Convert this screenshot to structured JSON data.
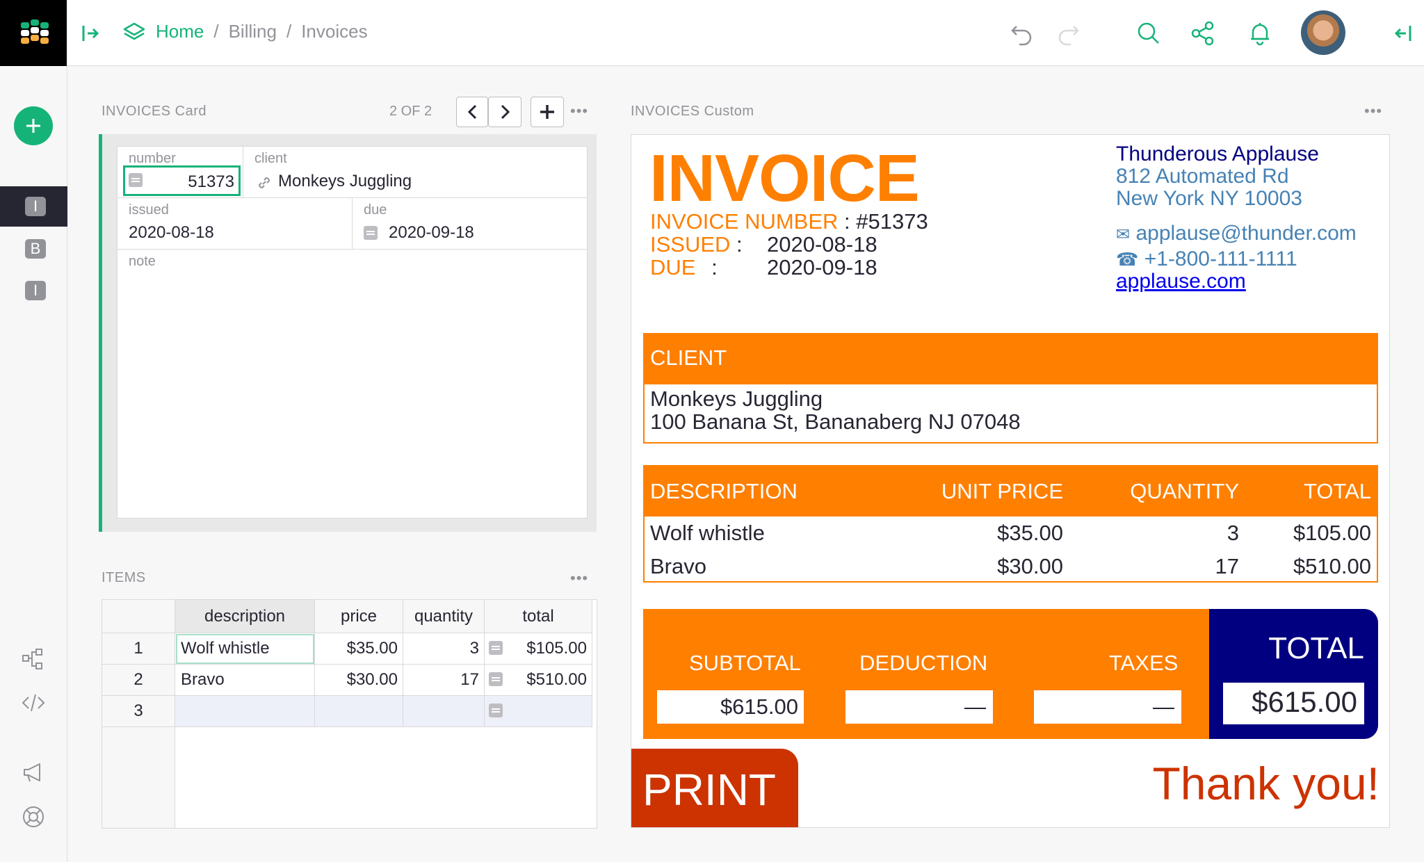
{
  "breadcrumb": {
    "home": "Home",
    "sep1": "/",
    "billing": "Billing",
    "sep2": "/",
    "invoices": "Invoices"
  },
  "sidebar": {
    "pages": [
      {
        "letter": "I"
      },
      {
        "letter": "B"
      },
      {
        "letter": "I"
      }
    ]
  },
  "card": {
    "title": "INVOICES Card",
    "pager": "2 OF 2",
    "menu": "•••",
    "fields": {
      "number_label": "number",
      "number_value": "51373",
      "client_label": "client",
      "client_value": "Monkeys Juggling",
      "issued_label": "issued",
      "issued_value": "2020-08-18",
      "due_label": "due",
      "due_value": "2020-09-18",
      "note_label": "note"
    }
  },
  "items": {
    "title": "ITEMS",
    "menu": "•••",
    "columns": [
      "description",
      "price",
      "quantity",
      "total"
    ],
    "rows": [
      {
        "n": "1",
        "description": "Wolf whistle",
        "price": "$35.00",
        "quantity": "3",
        "total": "$105.00"
      },
      {
        "n": "2",
        "description": "Bravo",
        "price": "$30.00",
        "quantity": "17",
        "total": "$510.00"
      },
      {
        "n": "3",
        "description": "",
        "price": "",
        "quantity": "",
        "total": ""
      }
    ]
  },
  "invoice": {
    "title": "INVOICES Custom",
    "menu": "•••",
    "heading": "INVOICE",
    "number_label": "INVOICE NUMBER",
    "number_value": ": #51373",
    "issued_label": "ISSUED",
    "issued_colon": ":",
    "issued_value": "2020-08-18",
    "due_label": "DUE",
    "due_colon": ":",
    "due_value": "2020-09-18",
    "company": {
      "name": "Thunderous Applause",
      "street": "812 Automated Rd",
      "city": "New York NY 10003",
      "email": "applause@thunder.com",
      "phone": "+1-800-111-1111",
      "website": "applause.com"
    },
    "client_header": "CLIENT",
    "client_name": "Monkeys Juggling",
    "client_address": "100 Banana St, Bananaberg NJ 07048",
    "table_headers": {
      "description": "DESCRIPTION",
      "unit_price": "UNIT PRICE",
      "quantity": "QUANTITY",
      "total": "TOTAL"
    },
    "lines": [
      {
        "description": "Wolf whistle",
        "unit_price": "$35.00",
        "quantity": "3",
        "total": "$105.00"
      },
      {
        "description": "Bravo",
        "unit_price": "$30.00",
        "quantity": "17",
        "total": "$510.00"
      }
    ],
    "subtotal_label": "SUBTOTAL",
    "subtotal_value": "$615.00",
    "deduction_label": "DEDUCTION",
    "deduction_value": "—",
    "taxes_label": "TAXES",
    "taxes_value": "—",
    "total_label": "TOTAL",
    "total_value": "$615.00",
    "print_label": "PRINT",
    "thanks": "Thank you!"
  },
  "colors": {
    "accent": "#16b378",
    "orange": "#ff7f00",
    "navy": "#000080",
    "print": "#cc3300"
  }
}
